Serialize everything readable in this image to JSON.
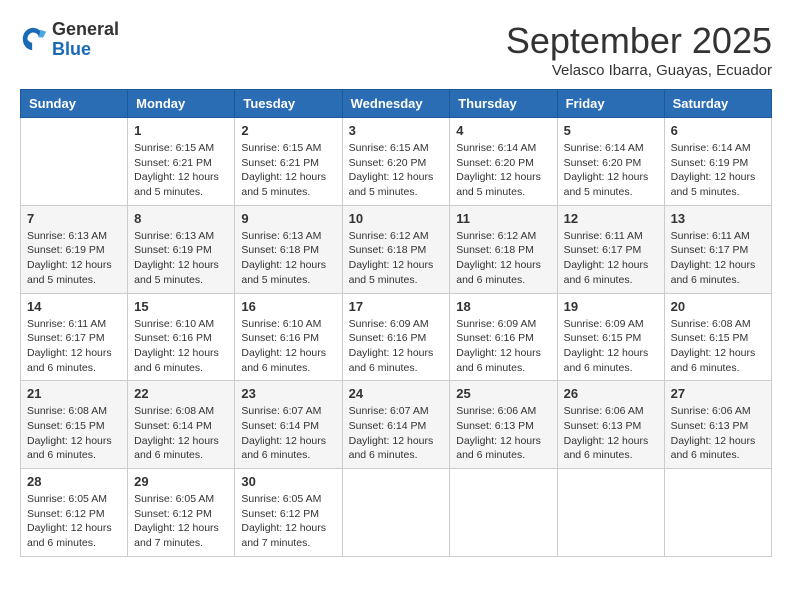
{
  "header": {
    "logo": {
      "general": "General",
      "blue": "Blue"
    },
    "title": "September 2025",
    "location": "Velasco Ibarra, Guayas, Ecuador"
  },
  "weekdays": [
    "Sunday",
    "Monday",
    "Tuesday",
    "Wednesday",
    "Thursday",
    "Friday",
    "Saturday"
  ],
  "weeks": [
    [
      {
        "day": null
      },
      {
        "day": 1,
        "sunrise": "6:15 AM",
        "sunset": "6:21 PM",
        "daylight": "12 hours and 5 minutes."
      },
      {
        "day": 2,
        "sunrise": "6:15 AM",
        "sunset": "6:21 PM",
        "daylight": "12 hours and 5 minutes."
      },
      {
        "day": 3,
        "sunrise": "6:15 AM",
        "sunset": "6:20 PM",
        "daylight": "12 hours and 5 minutes."
      },
      {
        "day": 4,
        "sunrise": "6:14 AM",
        "sunset": "6:20 PM",
        "daylight": "12 hours and 5 minutes."
      },
      {
        "day": 5,
        "sunrise": "6:14 AM",
        "sunset": "6:20 PM",
        "daylight": "12 hours and 5 minutes."
      },
      {
        "day": 6,
        "sunrise": "6:14 AM",
        "sunset": "6:19 PM",
        "daylight": "12 hours and 5 minutes."
      }
    ],
    [
      {
        "day": 7,
        "sunrise": "6:13 AM",
        "sunset": "6:19 PM",
        "daylight": "12 hours and 5 minutes."
      },
      {
        "day": 8,
        "sunrise": "6:13 AM",
        "sunset": "6:19 PM",
        "daylight": "12 hours and 5 minutes."
      },
      {
        "day": 9,
        "sunrise": "6:13 AM",
        "sunset": "6:18 PM",
        "daylight": "12 hours and 5 minutes."
      },
      {
        "day": 10,
        "sunrise": "6:12 AM",
        "sunset": "6:18 PM",
        "daylight": "12 hours and 5 minutes."
      },
      {
        "day": 11,
        "sunrise": "6:12 AM",
        "sunset": "6:18 PM",
        "daylight": "12 hours and 6 minutes."
      },
      {
        "day": 12,
        "sunrise": "6:11 AM",
        "sunset": "6:17 PM",
        "daylight": "12 hours and 6 minutes."
      },
      {
        "day": 13,
        "sunrise": "6:11 AM",
        "sunset": "6:17 PM",
        "daylight": "12 hours and 6 minutes."
      }
    ],
    [
      {
        "day": 14,
        "sunrise": "6:11 AM",
        "sunset": "6:17 PM",
        "daylight": "12 hours and 6 minutes."
      },
      {
        "day": 15,
        "sunrise": "6:10 AM",
        "sunset": "6:16 PM",
        "daylight": "12 hours and 6 minutes."
      },
      {
        "day": 16,
        "sunrise": "6:10 AM",
        "sunset": "6:16 PM",
        "daylight": "12 hours and 6 minutes."
      },
      {
        "day": 17,
        "sunrise": "6:09 AM",
        "sunset": "6:16 PM",
        "daylight": "12 hours and 6 minutes."
      },
      {
        "day": 18,
        "sunrise": "6:09 AM",
        "sunset": "6:16 PM",
        "daylight": "12 hours and 6 minutes."
      },
      {
        "day": 19,
        "sunrise": "6:09 AM",
        "sunset": "6:15 PM",
        "daylight": "12 hours and 6 minutes."
      },
      {
        "day": 20,
        "sunrise": "6:08 AM",
        "sunset": "6:15 PM",
        "daylight": "12 hours and 6 minutes."
      }
    ],
    [
      {
        "day": 21,
        "sunrise": "6:08 AM",
        "sunset": "6:15 PM",
        "daylight": "12 hours and 6 minutes."
      },
      {
        "day": 22,
        "sunrise": "6:08 AM",
        "sunset": "6:14 PM",
        "daylight": "12 hours and 6 minutes."
      },
      {
        "day": 23,
        "sunrise": "6:07 AM",
        "sunset": "6:14 PM",
        "daylight": "12 hours and 6 minutes."
      },
      {
        "day": 24,
        "sunrise": "6:07 AM",
        "sunset": "6:14 PM",
        "daylight": "12 hours and 6 minutes."
      },
      {
        "day": 25,
        "sunrise": "6:06 AM",
        "sunset": "6:13 PM",
        "daylight": "12 hours and 6 minutes."
      },
      {
        "day": 26,
        "sunrise": "6:06 AM",
        "sunset": "6:13 PM",
        "daylight": "12 hours and 6 minutes."
      },
      {
        "day": 27,
        "sunrise": "6:06 AM",
        "sunset": "6:13 PM",
        "daylight": "12 hours and 6 minutes."
      }
    ],
    [
      {
        "day": 28,
        "sunrise": "6:05 AM",
        "sunset": "6:12 PM",
        "daylight": "12 hours and 6 minutes."
      },
      {
        "day": 29,
        "sunrise": "6:05 AM",
        "sunset": "6:12 PM",
        "daylight": "12 hours and 7 minutes."
      },
      {
        "day": 30,
        "sunrise": "6:05 AM",
        "sunset": "6:12 PM",
        "daylight": "12 hours and 7 minutes."
      },
      {
        "day": null
      },
      {
        "day": null
      },
      {
        "day": null
      },
      {
        "day": null
      }
    ]
  ],
  "labels": {
    "sunrise": "Sunrise:",
    "sunset": "Sunset:",
    "daylight": "Daylight:"
  }
}
